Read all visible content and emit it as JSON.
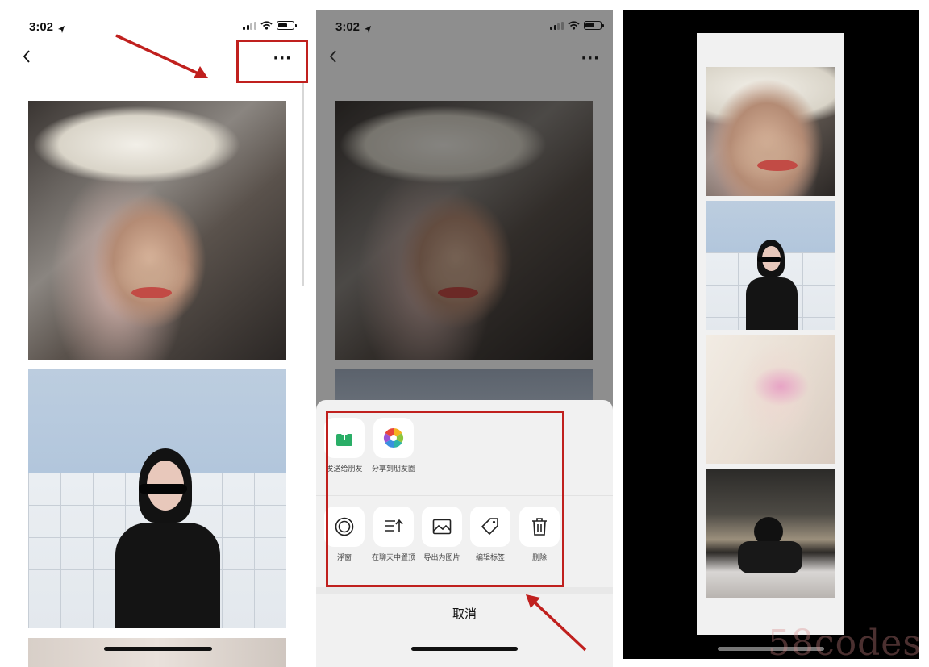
{
  "panel1": {
    "status": {
      "time": "3:02"
    },
    "navbar": {
      "more_label": "···"
    }
  },
  "panel2": {
    "status": {
      "time": "3:02"
    },
    "navbar": {
      "more_label": "···"
    },
    "share_sheet": {
      "row1": [
        {
          "label": "发送给朋友",
          "icon": "share-to-friend-icon",
          "color": "#2aae67"
        },
        {
          "label": "分享到朋友圈",
          "icon": "moments-icon"
        }
      ],
      "row2": [
        {
          "label": "浮窗",
          "icon": "floating-window-icon"
        },
        {
          "label": "在聊天中置顶",
          "icon": "pin-to-chat-icon"
        },
        {
          "label": "导出为图片",
          "icon": "export-image-icon"
        },
        {
          "label": "编辑标签",
          "icon": "tag-icon"
        },
        {
          "label": "删除",
          "icon": "trash-icon"
        }
      ],
      "cancel_label": "取消"
    }
  },
  "watermark": "58codes",
  "colors": {
    "highlight": "#c0201e",
    "wechat_green": "#2aae67"
  }
}
